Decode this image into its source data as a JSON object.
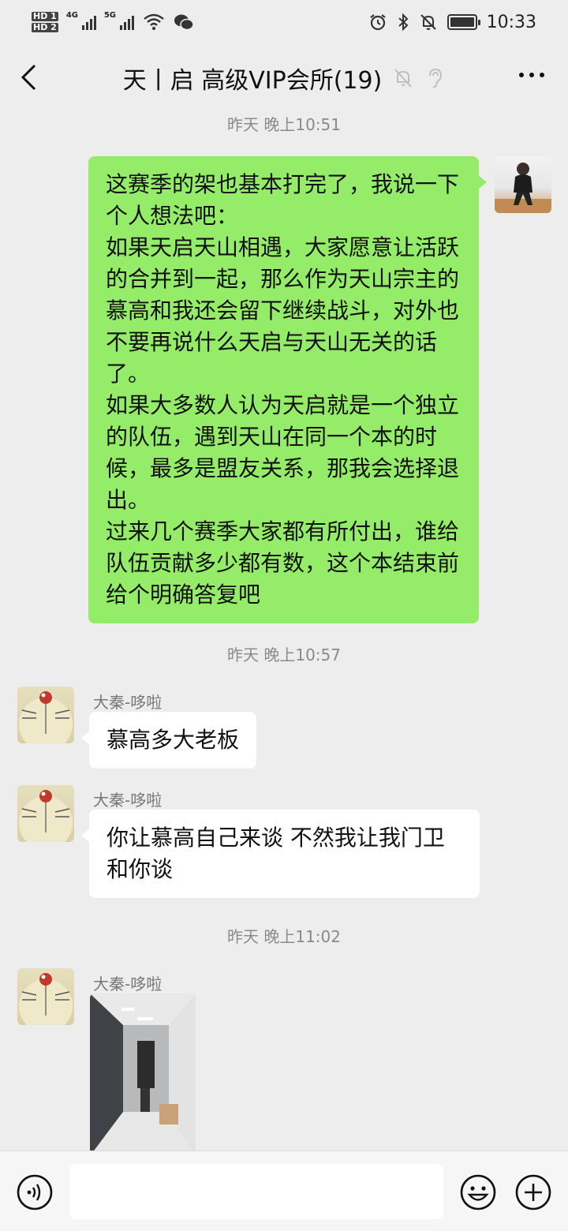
{
  "status_bar": {
    "hd1": "HD 1",
    "hd2": "HD 2",
    "net1": "4G",
    "net2": "5G",
    "time": "10:33"
  },
  "header": {
    "title": "天丨启 高级VIP会所(19)"
  },
  "messages": [
    {
      "type": "timestamp",
      "text": "昨天 晚上10:51"
    },
    {
      "type": "outgoing",
      "lines": [
        "这赛季的架也基本打完了，我说一下个人想法吧：",
        "如果天启天山相遇，大家愿意让活跃的合并到一起，那么作为天山宗主的慕高和我还会留下继续战斗，对外也不要再说什么天启与天山无关的话了。",
        "如果大多数人认为天启就是一个独立的队伍，遇到天山在同一个本的时候，最多是盟友关系，那我会选择退出。",
        "过来几个赛季大家都有所付出，谁给队伍贡献多少都有数，这个本结束前给个明确答复吧"
      ]
    },
    {
      "type": "timestamp",
      "text": "昨天 晚上10:57"
    },
    {
      "type": "incoming",
      "sender": "大秦-哆啦",
      "text": "慕高多大老板"
    },
    {
      "type": "incoming",
      "sender": "大秦-哆啦",
      "text": "你让慕高自己来谈 不然我让我门卫和你谈"
    },
    {
      "type": "timestamp",
      "text": "昨天 晚上11:02"
    },
    {
      "type": "incoming-image",
      "sender": "大秦-哆啦"
    }
  ],
  "input": {
    "value": "",
    "placeholder": ""
  },
  "colors": {
    "outgoing_bubble": "#95ec69",
    "incoming_bubble": "#ffffff",
    "background": "#ededed"
  }
}
